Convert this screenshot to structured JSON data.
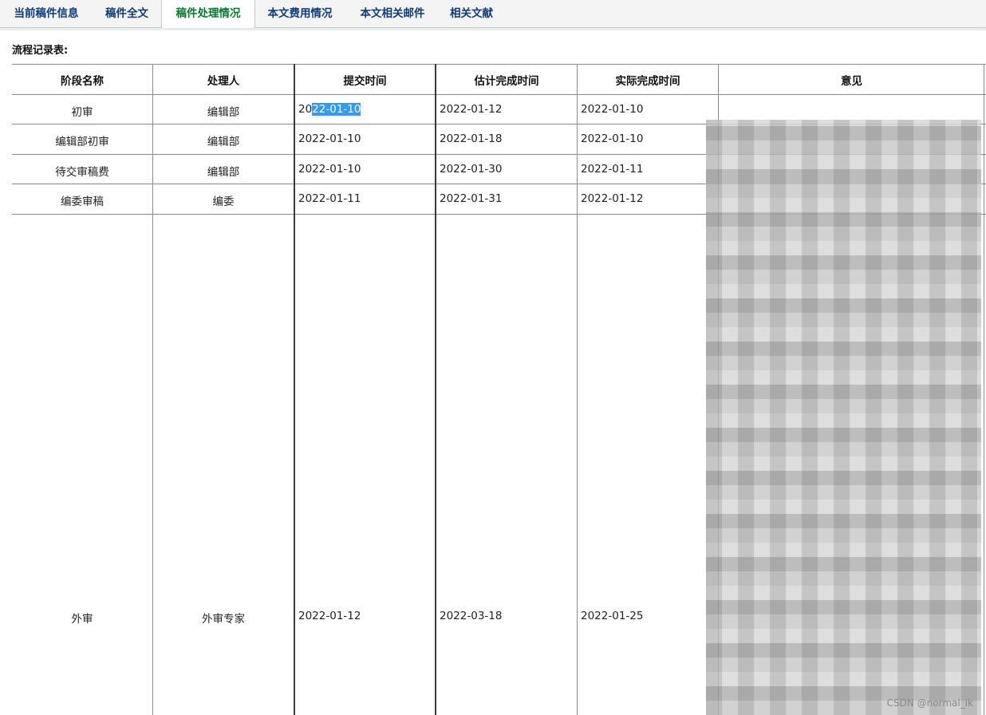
{
  "tabs": [
    {
      "label": "当前稿件信息"
    },
    {
      "label": "稿件全文"
    },
    {
      "label": "稿件处理情况",
      "active": true
    },
    {
      "label": "本文费用情况"
    },
    {
      "label": "本文相关邮件"
    },
    {
      "label": "相关文献"
    }
  ],
  "section_title": "流程记录表:",
  "table": {
    "headers": [
      "阶段名称",
      "处理人",
      "提交时间",
      "估计完成时间",
      "实际完成时间",
      "意见"
    ],
    "rows": [
      {
        "stage": "初审",
        "handler": "编辑部",
        "submit_prefix": "20",
        "submit_selected": "22-01-10",
        "estimate": "2022-01-12",
        "actual": "2022-01-10"
      },
      {
        "stage": "编辑部初审",
        "handler": "编辑部",
        "submit": "2022-01-10",
        "estimate": "2022-01-18",
        "actual": "2022-01-10"
      },
      {
        "stage": "待交审稿费",
        "handler": "编辑部",
        "submit": "2022-01-10",
        "estimate": "2022-01-30",
        "actual": "2022-01-11"
      },
      {
        "stage": "编委审稿",
        "handler": "编委",
        "submit": "2022-01-11",
        "estimate": "2022-01-31",
        "actual": "2022-01-12"
      },
      {
        "stage": "外审",
        "handler": "外审专家",
        "submit": "2022-01-12",
        "estimate": "2022-03-18",
        "actual": "2022-01-25"
      }
    ]
  },
  "watermark": "CSDN @normal_lk",
  "colors": {
    "active_tab": "#007a2a",
    "tab_text": "#0b3b7a",
    "selection": "#3399ff"
  }
}
